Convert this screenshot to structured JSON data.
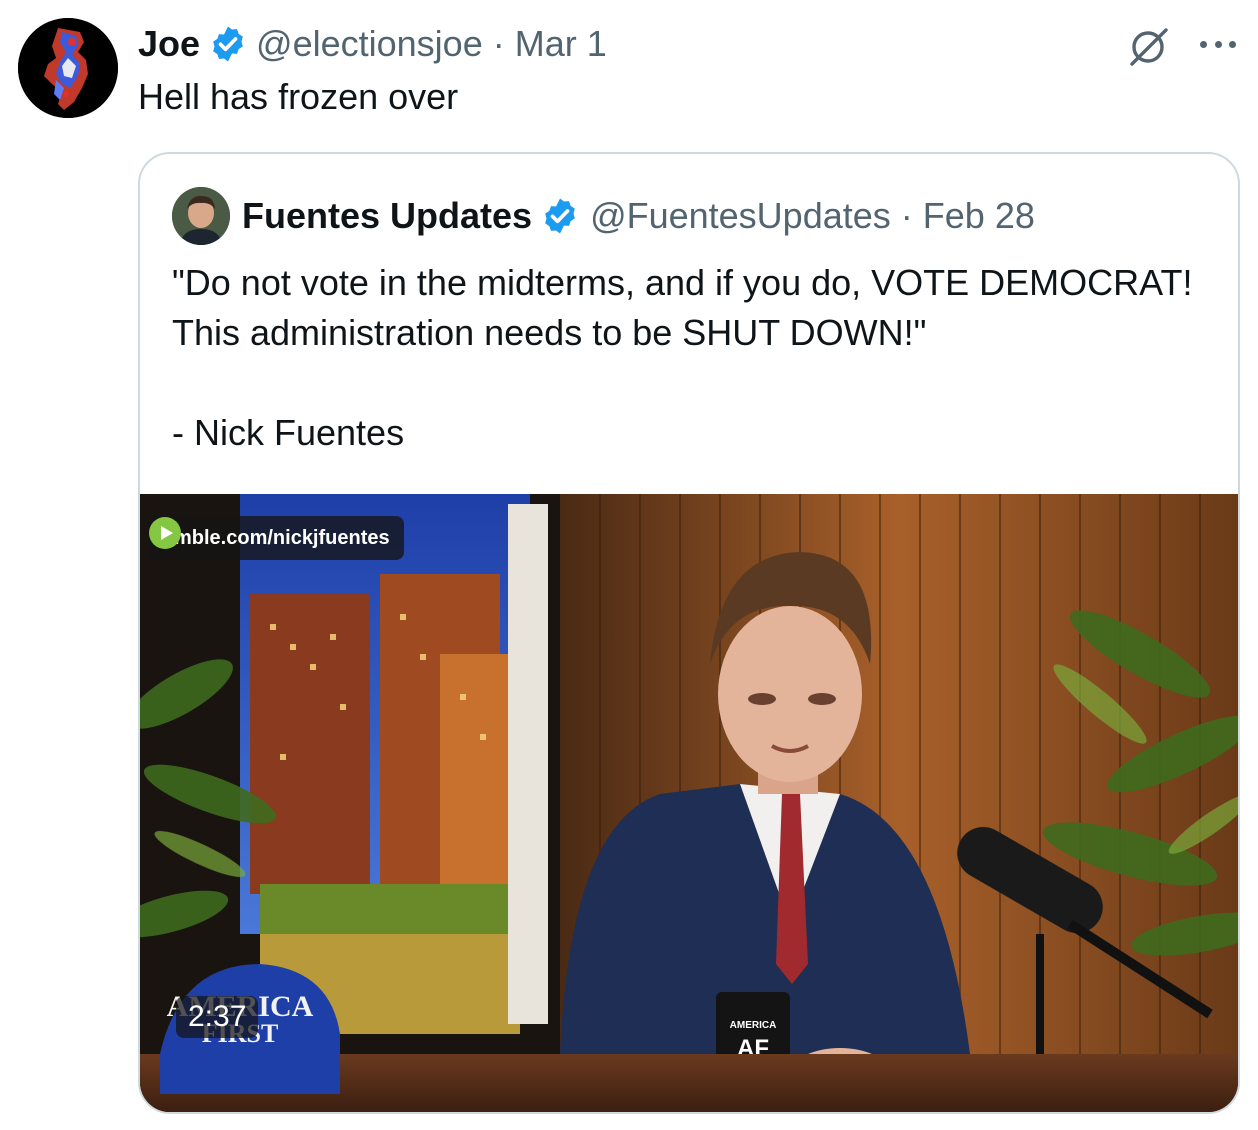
{
  "tweet": {
    "author_name": "Joe",
    "handle": "@electionsjoe",
    "separator": "·",
    "date": "Mar 1",
    "text": "Hell has frozen over",
    "avatar_icon": "new-jersey-map-avatar",
    "verified_icon": "verified-badge-icon",
    "grok_icon": "grok-icon",
    "more_icon": "more-options-icon"
  },
  "quote": {
    "author_name": "Fuentes Updates",
    "handle": "@FuentesUpdates",
    "separator": "·",
    "date": "Feb 28",
    "text_line1": "\"Do not vote in the midterms, and if you do, VOTE DEMOCRAT! This administration needs to be SHUT DOWN!\"",
    "text_line2": "- Nick Fuentes",
    "media": {
      "source_label": "rumble.com/nickjfuentes",
      "duration": "2:37",
      "hat_text_1": "AMERICA",
      "hat_text_2": "FIRST",
      "mug_text": "AMERICA",
      "mug_logo": "AF"
    }
  },
  "colors": {
    "text_primary": "#0f1419",
    "text_secondary": "#536471",
    "verified_blue": "#1d9bf0",
    "border": "#cfd9de",
    "rumble_green": "#85c742"
  }
}
